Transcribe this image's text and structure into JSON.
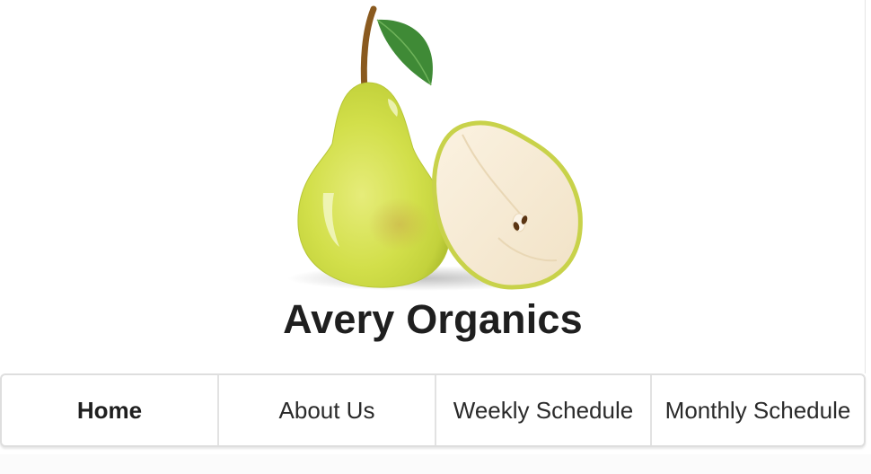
{
  "site": {
    "brand_name": "Avery Organics",
    "logo_icon": "pear-logo-icon"
  },
  "nav": {
    "items": [
      {
        "label": "Home",
        "active": true
      },
      {
        "label": "About Us",
        "active": false
      },
      {
        "label": "Weekly Schedule",
        "active": false
      },
      {
        "label": "Monthly Schedule",
        "active": false
      }
    ]
  },
  "colors": {
    "brand_text": "#1f1f1f",
    "nav_border": "#dedede",
    "pear_skin": "#cfe14a",
    "pear_flesh": "#f7ead2",
    "leaf": "#3f8a36",
    "stem": "#8a5a1f"
  }
}
